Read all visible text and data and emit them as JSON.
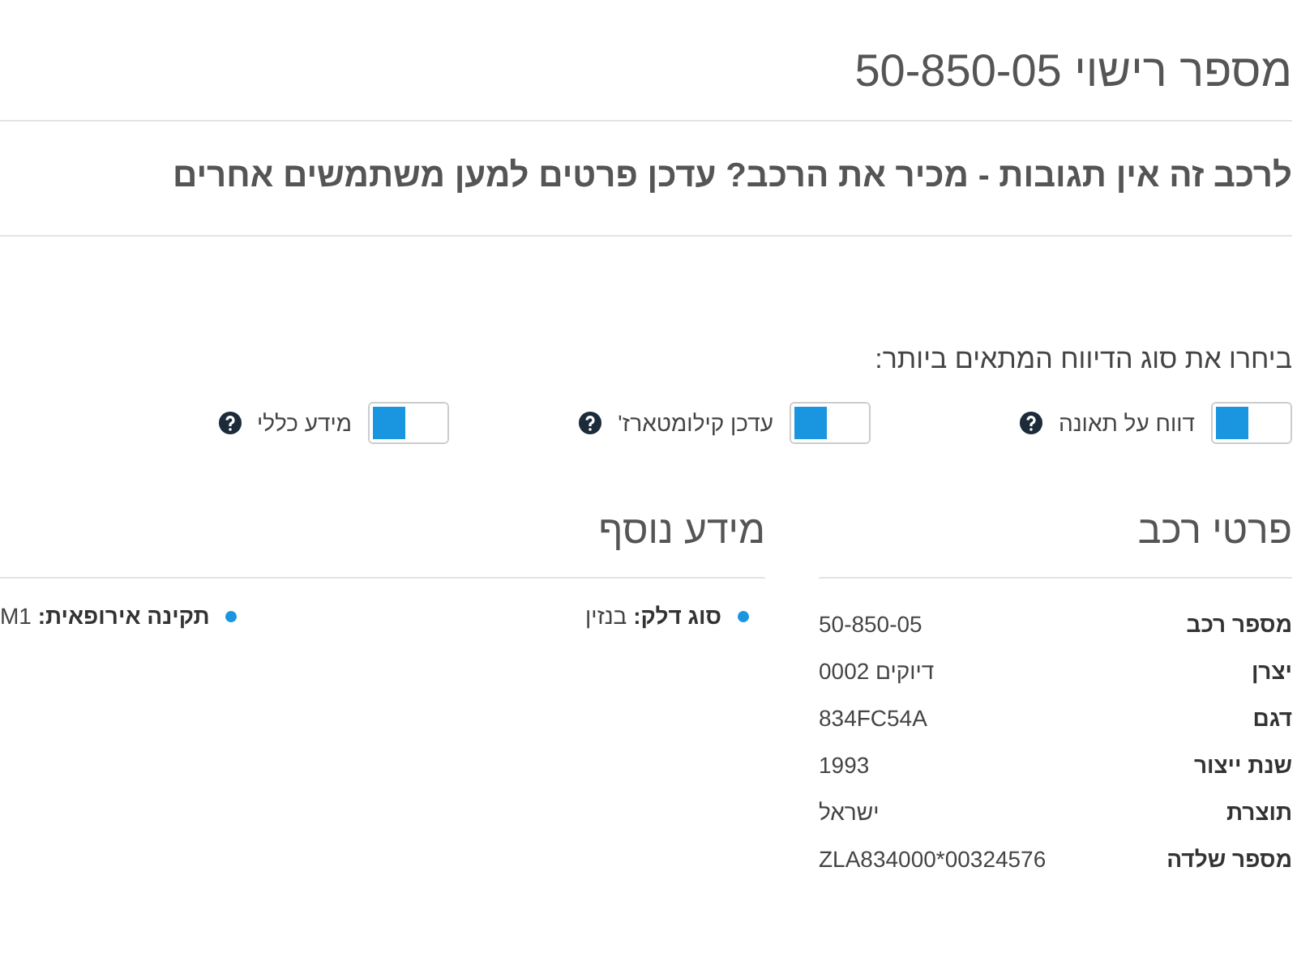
{
  "page_title": "מספר רישוי 50-850-05",
  "notice": "לרכב זה אין תגובות - מכיר את הרכב? עדכן פרטים למען משתמשים אחרים",
  "report_prompt": "ביחרו את סוג הדיווח המתאים ביותר:",
  "report_types": [
    {
      "label": "דווח על תאונה",
      "on": false
    },
    {
      "label": "עדכן קילומטארז'",
      "on": false
    },
    {
      "label": "מידע כללי",
      "on": false
    }
  ],
  "vehicle_details": {
    "title": "פרטי רכב",
    "rows": [
      {
        "label": "מספר רכב",
        "value": "50-850-05"
      },
      {
        "label": "יצרן",
        "value": "דיוקים 0002"
      },
      {
        "label": "דגם",
        "value": "834FC54A"
      },
      {
        "label": "שנת ייצור",
        "value": "1993"
      },
      {
        "label": "תוצרת",
        "value": "ישראל"
      },
      {
        "label": "מספר שלדה",
        "value": "ZLA834000*00324576"
      }
    ]
  },
  "extra_info": {
    "title": "מידע נוסף",
    "items": [
      "**סוג דלק:** בנזין",
      "**תקינה אירופאית:** M1"
    ]
  }
}
